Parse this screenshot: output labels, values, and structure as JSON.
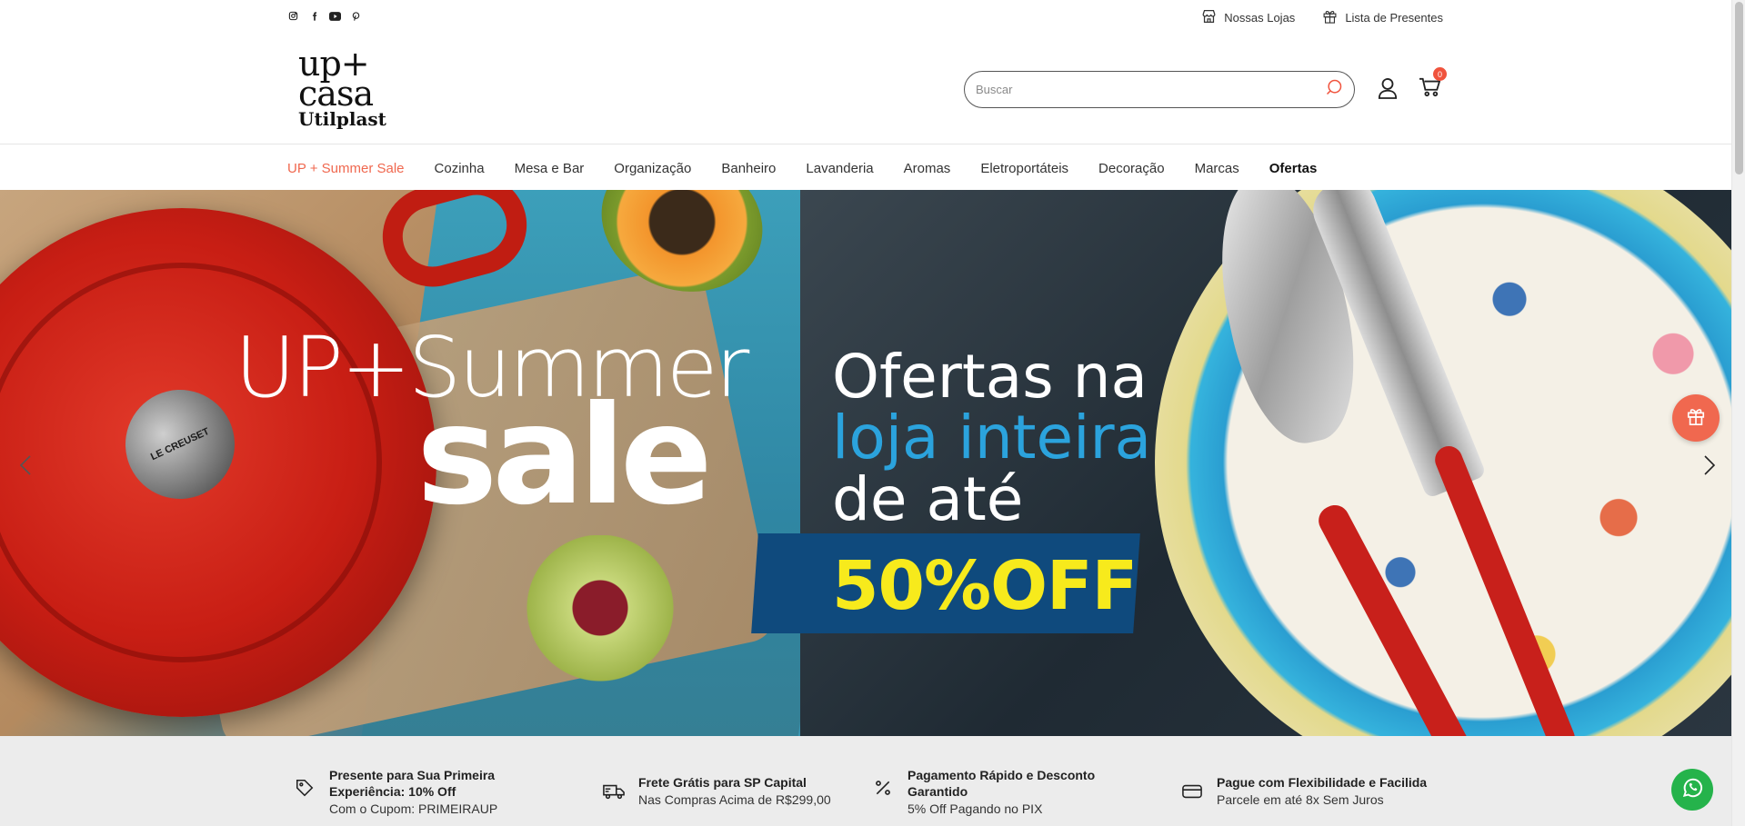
{
  "topbar": {
    "social_icons": [
      "instagram-icon",
      "facebook-icon",
      "youtube-icon",
      "pinterest-icon"
    ],
    "links": [
      {
        "label": "Nossas Lojas",
        "icon": "store-icon"
      },
      {
        "label": "Lista de Presentes",
        "icon": "gift-icon"
      }
    ]
  },
  "header": {
    "logo": {
      "line1": "up+",
      "line2": "casa",
      "line3": "Utilplast"
    },
    "search": {
      "placeholder": "Buscar",
      "value": ""
    },
    "cart_count": "0"
  },
  "nav": {
    "items": [
      "UP + Summer Sale",
      "Cozinha",
      "Mesa e Bar",
      "Organização",
      "Banheiro",
      "Lavanderia",
      "Aromas",
      "Eletroportáteis",
      "Decoração",
      "Marcas",
      "Ofertas"
    ]
  },
  "hero": {
    "summer": "UP+Summer",
    "sale": "sale",
    "line1": "Ofertas na",
    "line2": "loja inteira",
    "line3": "de até",
    "discount": "50%OFF",
    "pot_brand": "LE CREUSET"
  },
  "benefits": [
    {
      "icon": "tag-icon",
      "title": "Presente para Sua Primeira Experiência: 10% Off",
      "subtitle": "Com o Cupom: PRIMEIRAUP"
    },
    {
      "icon": "truck-icon",
      "title": "Frete Grátis para SP Capital",
      "subtitle": "Nas Compras Acima de R$299,00"
    },
    {
      "icon": "percent-icon",
      "title": "Pagamento Rápido e Desconto Garantido",
      "subtitle": "5% Off Pagando no PIX"
    },
    {
      "icon": "credit-card-icon",
      "title": "Pague com Flexibilidade e Facilida",
      "subtitle": "Parcele em até 8x Sem Juros"
    }
  ],
  "colors": {
    "accent": "#f0684f",
    "whatsapp": "#25b34b",
    "offer_yellow": "#f7ea1c",
    "offer_box": "#0f4a7d",
    "loja_blue": "#2ba3dd"
  }
}
